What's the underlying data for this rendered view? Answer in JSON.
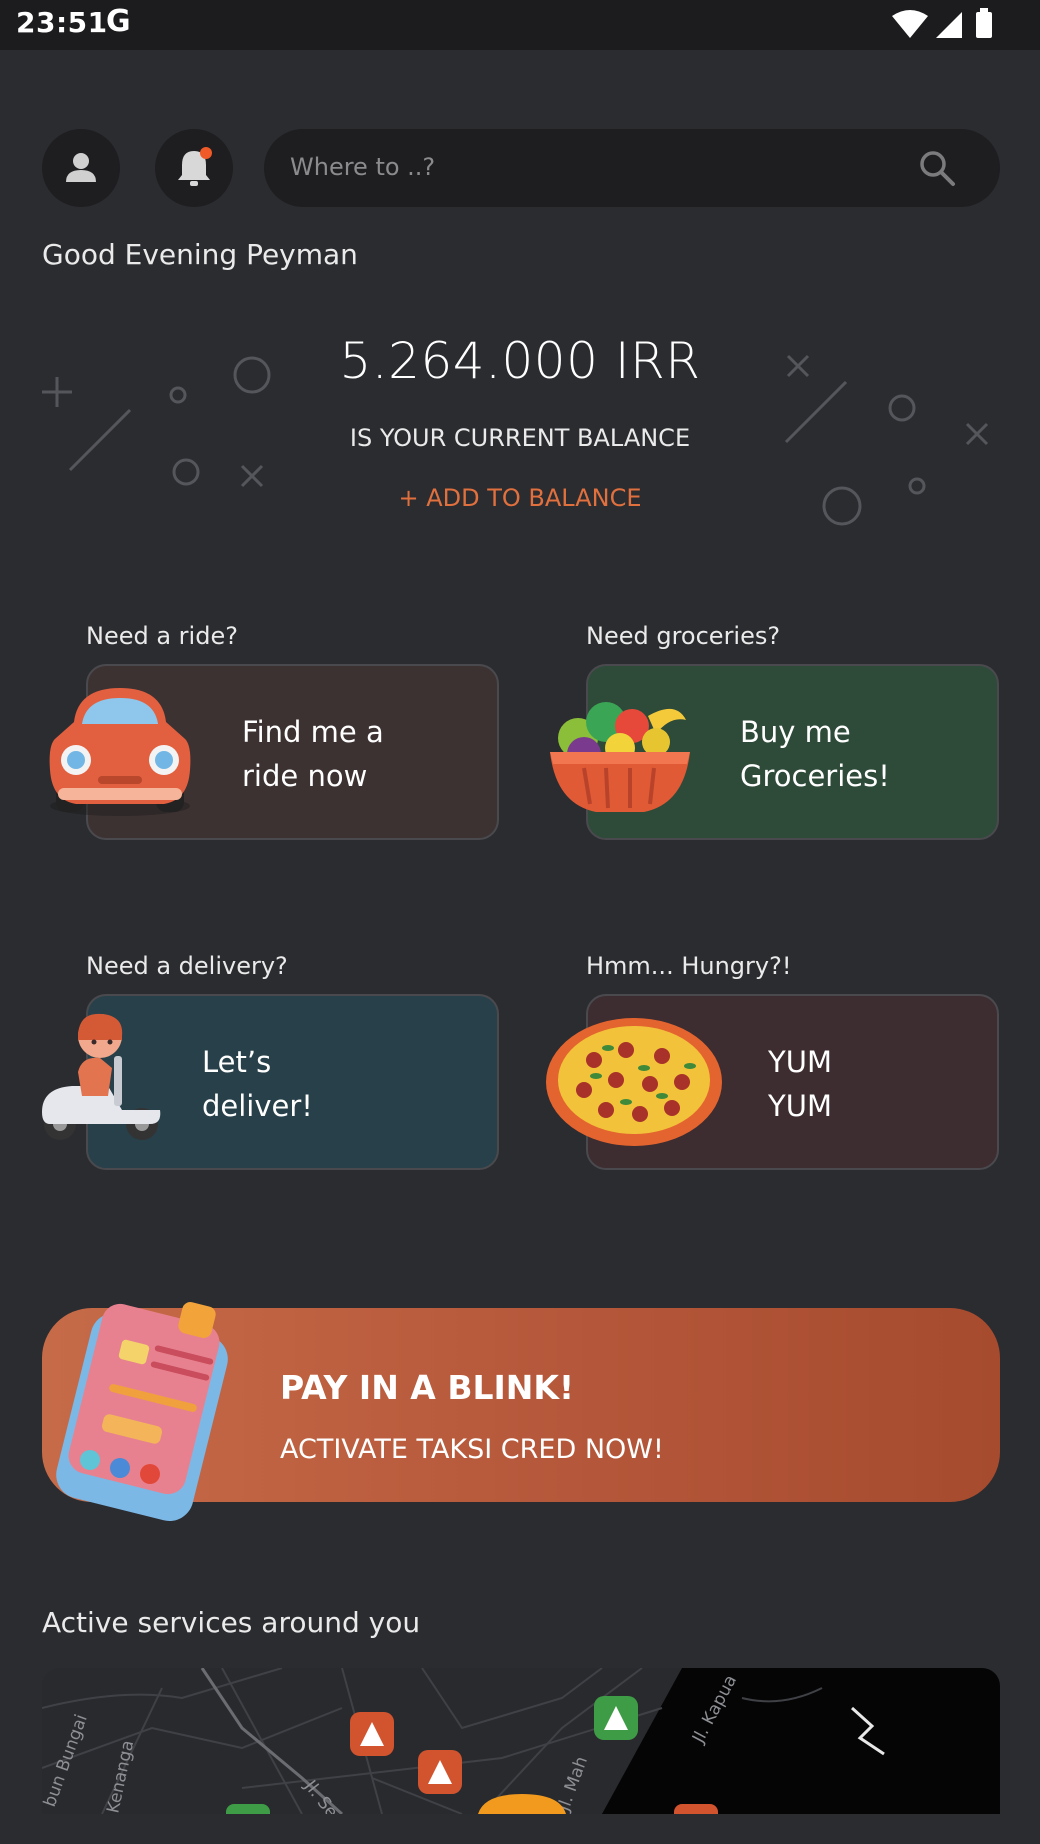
{
  "status_bar": {
    "time": "23:51",
    "google_letter": "G"
  },
  "header": {
    "profile_icon": "person-icon",
    "notification_icon": "bell-icon",
    "search": {
      "placeholder": "Where to ..?",
      "value": ""
    }
  },
  "greeting": "Good Evening Peyman",
  "balance": {
    "amount": "5.264.000 IRR",
    "caption": "IS YOUR CURRENT BALANCE",
    "add_label": "+ ADD TO BALANCE"
  },
  "services": [
    {
      "title": "Need a ride?",
      "label_line1": "Find me a",
      "label_line2": "ride now",
      "icon": "car-icon",
      "color": "#3d3232"
    },
    {
      "title": "Need groceries?",
      "label_line1": "Buy me",
      "label_line2": "Groceries!",
      "icon": "fruit-basket-icon",
      "color": "#2e4a39"
    },
    {
      "title": "Need a delivery?",
      "label_line1": "Let’s",
      "label_line2": "deliver!",
      "icon": "delivery-scooter-icon",
      "color": "#28404a"
    },
    {
      "title": "Hmm... Hungry?!",
      "label_line1": "YUM",
      "label_line2": "YUM",
      "icon": "pizza-icon",
      "color": "#3d2c30"
    }
  ],
  "promo": {
    "headline": "PAY IN A BLINK!",
    "subline": "ACTIVATE TAKSI CRED NOW!",
    "icon": "phone-wallet-icon"
  },
  "active_services": {
    "title": "Active services around you",
    "street_labels": [
      "bun Bungai",
      "Kenanga",
      "Jl. Ser",
      "Jl. Mah",
      "Jl. Kapua"
    ]
  },
  "colors": {
    "accent": "#e0703e",
    "background": "#2b2c30"
  }
}
